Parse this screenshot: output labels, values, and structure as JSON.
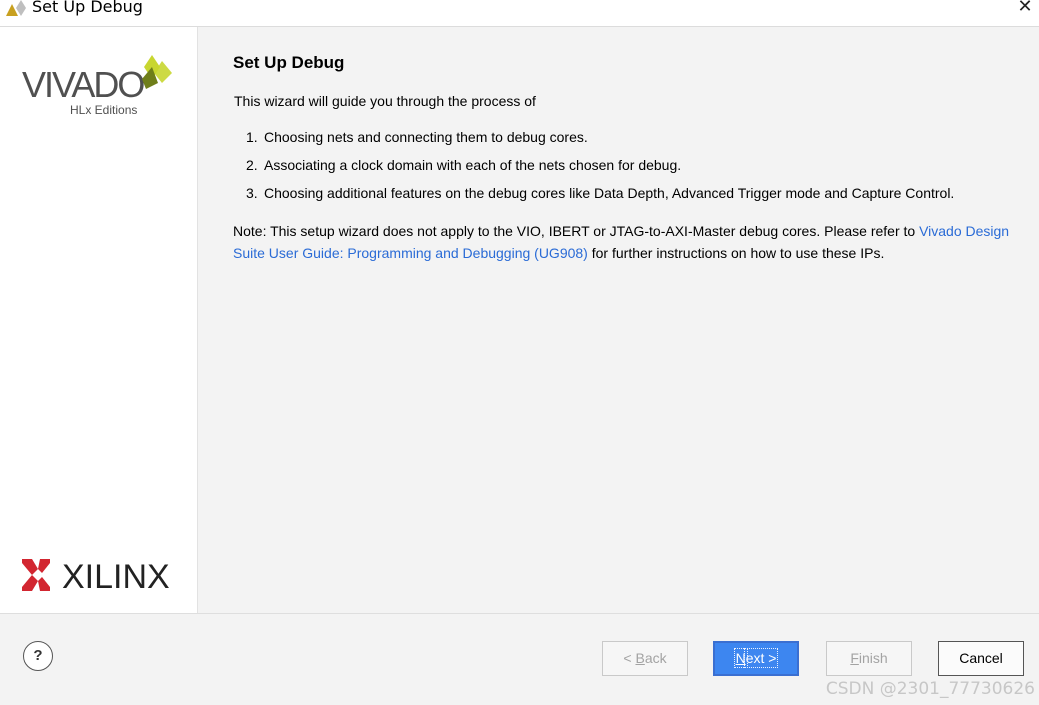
{
  "window": {
    "title": "Set Up Debug",
    "close_icon": "close-icon"
  },
  "sidebar": {
    "vivado_logo": {
      "brand": "VIVADO",
      "suffix": "HLx Editions",
      "colors": {
        "leaf_light": "#c8d630",
        "leaf_dark": "#6f7e1a",
        "text": "#505050"
      }
    },
    "xilinx_logo": {
      "brand": "XILINX",
      "colors": {
        "mark": "#d22630",
        "text": "#222222"
      }
    }
  },
  "main": {
    "heading": "Set Up Debug",
    "intro": "This wizard will guide you through the process of",
    "steps": [
      {
        "num": "1.",
        "text": "Choosing nets and connecting them to debug cores."
      },
      {
        "num": "2.",
        "text": "Associating a clock domain with each of the nets chosen for debug."
      },
      {
        "num": "3.",
        "text": "Choosing additional features on the debug cores like Data Depth, Advanced Trigger mode and Capture Control."
      }
    ],
    "note_prefix": "Note: This setup wizard does not apply to the VIO, IBERT or JTAG-to-AXI-Master debug cores. Please refer to ",
    "note_link": "Vivado Design Suite User Guide: Programming and Debugging (UG908)",
    "note_suffix": " for further instructions on how to use these IPs.",
    "link_color": "#2a6bd6"
  },
  "footer": {
    "help_label": "?",
    "buttons": {
      "back": {
        "mnemonic": "< ",
        "underlined": "B",
        "rest": "ack",
        "state": "disabled"
      },
      "next": {
        "underlined": "N",
        "rest": "ext >",
        "state": "default"
      },
      "finish": {
        "underlined": "F",
        "rest": "inish",
        "state": "disabled"
      },
      "cancel": {
        "label": "Cancel",
        "state": "enabled"
      }
    },
    "primary_color": "#3d86f0"
  },
  "watermark": "CSDN @2301_77730626"
}
